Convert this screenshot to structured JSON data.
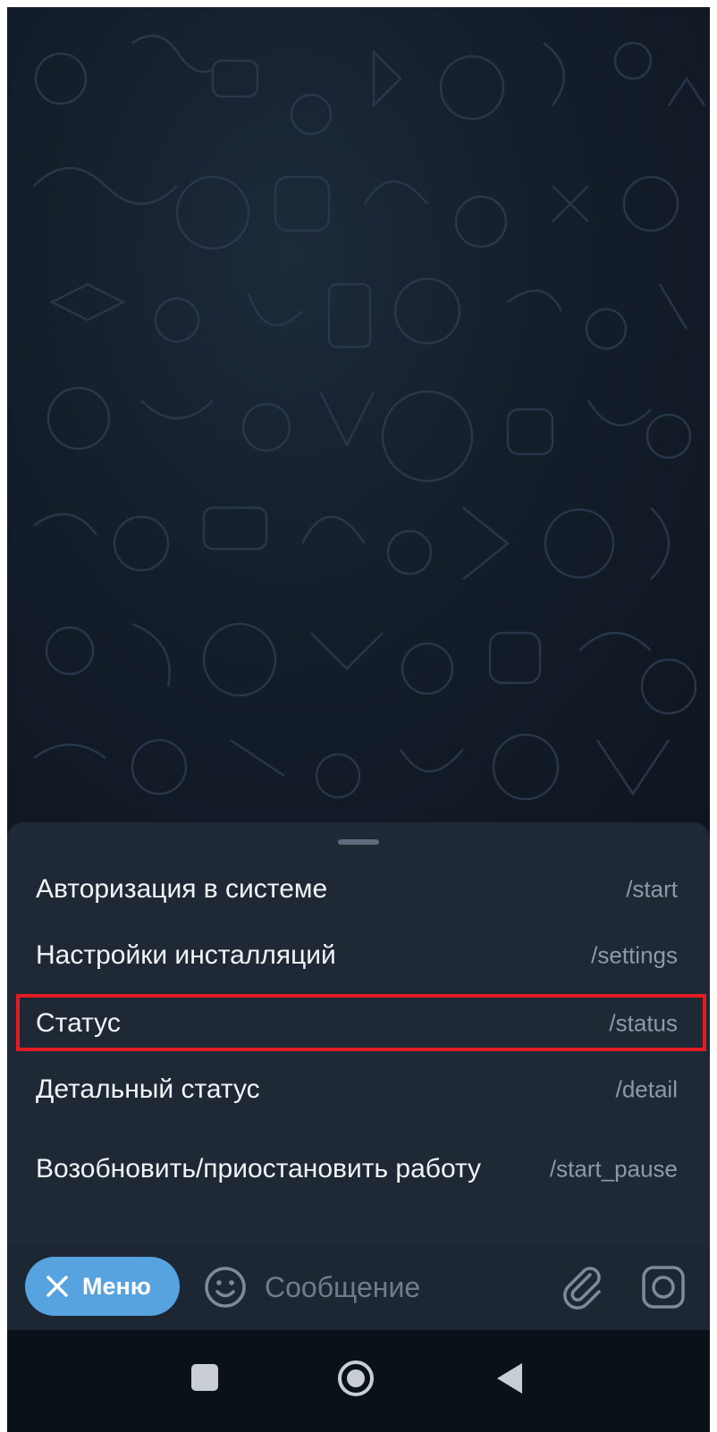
{
  "commands": [
    {
      "description": "Авторизация в системе",
      "command": "/start"
    },
    {
      "description": "Настройки инсталляций",
      "command": "/settings"
    },
    {
      "description": "Статус",
      "command": "/status"
    },
    {
      "description": "Детальный статус",
      "command": "/detail"
    },
    {
      "description": "Возобновить/приостановить работу",
      "command": "/start_pause"
    }
  ],
  "highlighted_command": "/status",
  "input_bar": {
    "menu_label": "Меню",
    "message_placeholder": "Сообщение",
    "icons": [
      "close-icon",
      "emoji-icon",
      "paperclip-icon",
      "camera-icon"
    ]
  },
  "nav_bar": {
    "icons": [
      "recents-square-icon",
      "home-circle-icon",
      "back-triangle-icon"
    ]
  },
  "colors": {
    "background": "#0f1722",
    "sheet": "#1f2936",
    "accent": "#56a3df",
    "highlight_border": "#e31b23",
    "command_text": "#8c99a8"
  }
}
